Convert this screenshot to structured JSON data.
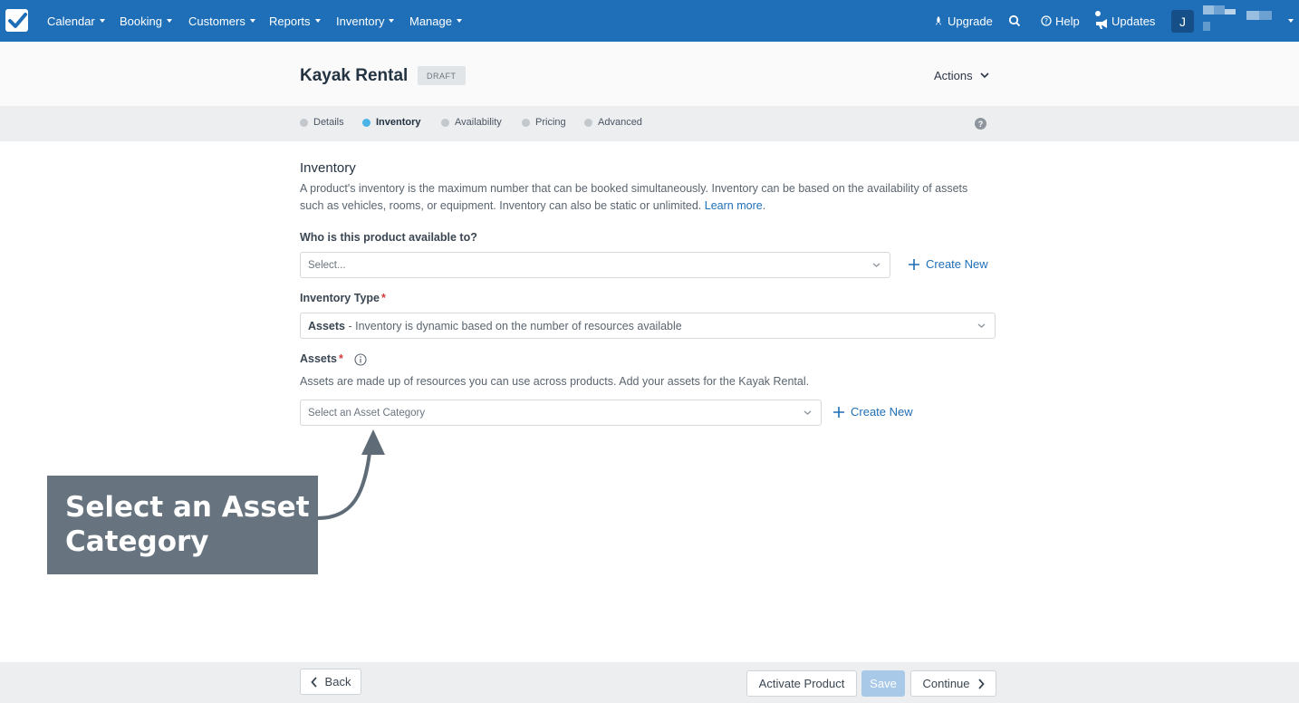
{
  "nav": {
    "items": [
      {
        "label": "Calendar"
      },
      {
        "label": "Booking"
      },
      {
        "label": "Customers"
      },
      {
        "label": "Reports"
      },
      {
        "label": "Inventory"
      },
      {
        "label": "Manage"
      }
    ],
    "upgrade": "Upgrade",
    "help": "Help",
    "updates": "Updates",
    "avatar_initial": "J",
    "brand_color": "#1e6fb8"
  },
  "header": {
    "title": "Kayak Rental",
    "status_badge": "DRAFT",
    "actions_label": "Actions"
  },
  "steps": [
    {
      "label": "Details",
      "active": false
    },
    {
      "label": "Inventory",
      "active": true
    },
    {
      "label": "Availability",
      "active": false
    },
    {
      "label": "Pricing",
      "active": false
    },
    {
      "label": "Advanced",
      "active": false
    }
  ],
  "help_glyph": "?",
  "content": {
    "section_title": "Inventory",
    "description": "A product's inventory is the maximum number that can be booked simultaneously. Inventory can be based on the availability of assets such as vehicles, rooms, or equipment. Inventory can also be static or unlimited.",
    "learn_more": "Learn more",
    "availability_label": "Who is this product available to?",
    "availability_placeholder": "Select...",
    "create_new": "Create New",
    "inventory_type_label": "Inventory Type",
    "inventory_type_value_bold": "Assets",
    "inventory_type_value_rest": " - Inventory is dynamic based on the number of resources available",
    "required_mark": "*",
    "assets_label": "Assets",
    "assets_description": "Assets are made up of resources you can use across products. Add your assets for the Kayak Rental.",
    "asset_category_placeholder": "Select an Asset Category"
  },
  "callout": {
    "line1": "Select an Asset",
    "line2": "Category"
  },
  "footer": {
    "back": "Back",
    "activate": "Activate Product",
    "save": "Save",
    "continue": "Continue"
  }
}
